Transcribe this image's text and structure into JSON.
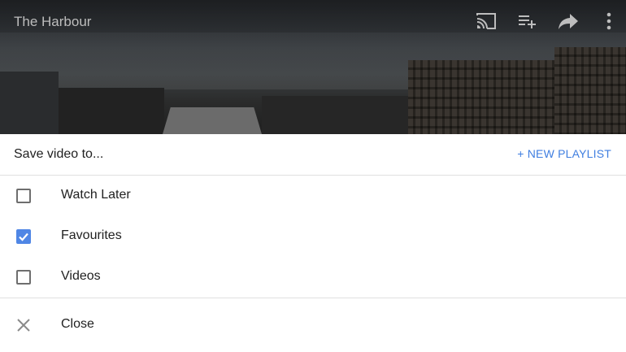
{
  "video": {
    "title": "The Harbour",
    "icons": [
      "cast-icon",
      "add-to-queue-icon",
      "share-icon",
      "more-vert-icon"
    ]
  },
  "dialog": {
    "title": "Save video to...",
    "new_playlist": "+ NEW PLAYLIST",
    "playlists": [
      {
        "label": "Watch Later",
        "checked": false
      },
      {
        "label": "Favourites",
        "checked": true
      },
      {
        "label": "Videos",
        "checked": false
      }
    ],
    "close_label": "Close"
  },
  "colors": {
    "accent": "#3f7ee0",
    "checkbox_checked": "#4f86e5",
    "text_primary": "#212121"
  }
}
